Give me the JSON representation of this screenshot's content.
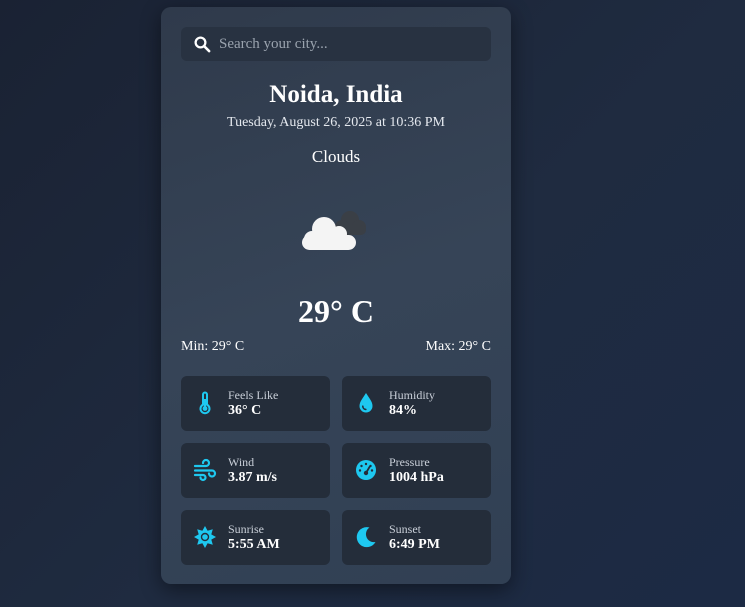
{
  "search": {
    "placeholder": "Search your city...",
    "icon": "search-icon"
  },
  "location": {
    "city": "Noida, India",
    "datetime": "Tuesday, August 26, 2025 at 10:36 PM"
  },
  "weather": {
    "condition": "Clouds",
    "icon": "clouds-icon",
    "temperature": "29° C",
    "min": "Min: 29° C",
    "max": "Max: 29° C"
  },
  "details": [
    {
      "label": "Feels Like",
      "value": "36° C",
      "icon": "thermometer-icon"
    },
    {
      "label": "Humidity",
      "value": "84%",
      "icon": "droplet-icon"
    },
    {
      "label": "Wind",
      "value": "3.87 m/s",
      "icon": "wind-icon"
    },
    {
      "label": "Pressure",
      "value": "1004 hPa",
      "icon": "gauge-icon"
    },
    {
      "label": "Sunrise",
      "value": "5:55 AM",
      "icon": "sun-icon"
    },
    {
      "label": "Sunset",
      "value": "6:49 PM",
      "icon": "moon-icon"
    }
  ],
  "colors": {
    "accent": "#1ec8f0",
    "card": "#334155",
    "tile": "#242d3a"
  }
}
